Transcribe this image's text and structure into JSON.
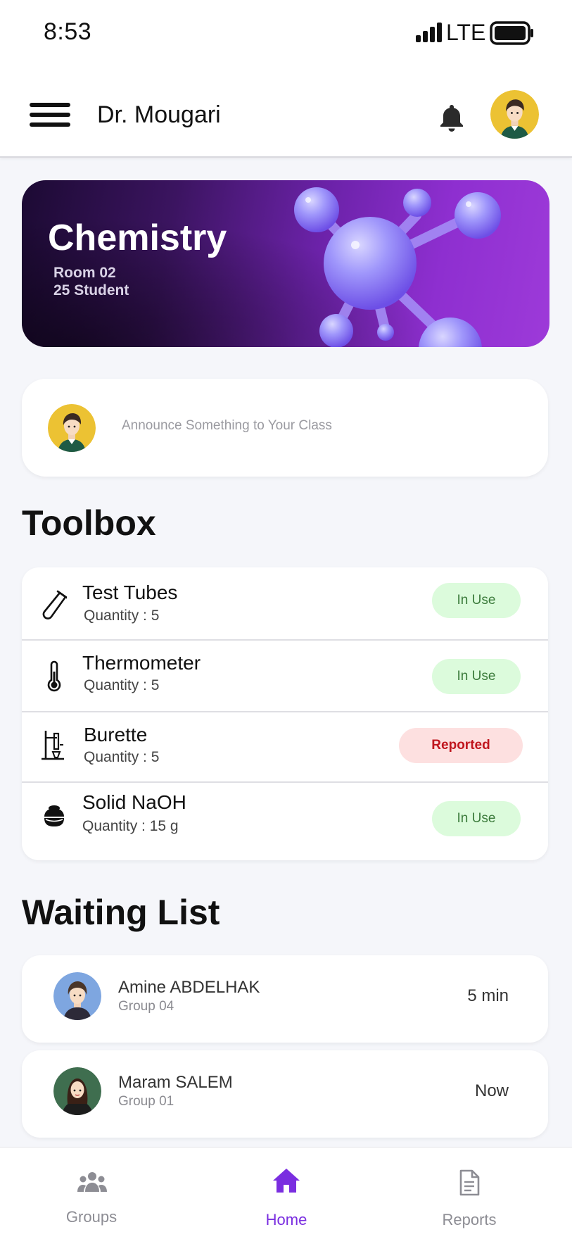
{
  "status_bar": {
    "time": "8:53",
    "network": "LTE"
  },
  "header": {
    "title": "Dr. Mougari"
  },
  "banner": {
    "subject": "Chemistry",
    "room": "Room 02",
    "students": "25 Student"
  },
  "announce": {
    "placeholder": "Announce Something to Your Class"
  },
  "toolbox": {
    "title": "Toolbox",
    "items": [
      {
        "name": "Test Tubes",
        "quantity": "Quantity : 5",
        "status": "In Use",
        "icon": "test-tube-icon"
      },
      {
        "name": "Thermometer",
        "quantity": "Quantity : 5",
        "status": "In Use",
        "icon": "thermometer-icon"
      },
      {
        "name": "Burette",
        "quantity": "Quantity : 5",
        "status": "Reported",
        "icon": "burette-icon"
      },
      {
        "name": "Solid NaOH",
        "quantity": "Quantity : 15 g",
        "status": "In Use",
        "icon": "weight-icon"
      }
    ]
  },
  "waiting_list": {
    "title": "Waiting List",
    "entries": [
      {
        "name": "Amine ABDELHAK",
        "group": "Group 04",
        "time": "5 min"
      },
      {
        "name": "Maram SALEM",
        "group": "Group 01",
        "time": "Now"
      }
    ]
  },
  "nav": {
    "items": [
      {
        "label": "Groups",
        "icon": "groups-icon"
      },
      {
        "label": "Home",
        "icon": "home-icon",
        "active": true
      },
      {
        "label": "Reports",
        "icon": "reports-icon"
      }
    ]
  },
  "colors": {
    "accent": "#7a2ee0",
    "in_use_bg": "#dcfbdc",
    "reported_bg": "#fde0e0",
    "reported_text": "#c0161e"
  }
}
